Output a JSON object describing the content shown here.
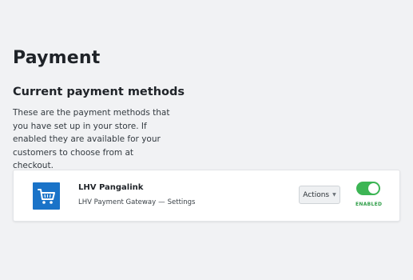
{
  "page": {
    "title": "Payment"
  },
  "section": {
    "title": "Current payment methods",
    "description": "These are the payment methods that you have set up in your store. If enabled they are available for your customers to choose from at checkout."
  },
  "methods": [
    {
      "name": "LHV Pangalink",
      "gateway": "LHV Payment Gateway",
      "separator": "—",
      "settings_label": "Settings",
      "actions_label": "Actions",
      "enabled": true,
      "status_label": "ENABLED",
      "logo_icon": "shopping-cart-icon"
    }
  ],
  "colors": {
    "background": "#f1f2f4",
    "logo": "#1a73c8",
    "toggle_on": "#3cb554",
    "enabled_text": "#2f9e48"
  }
}
